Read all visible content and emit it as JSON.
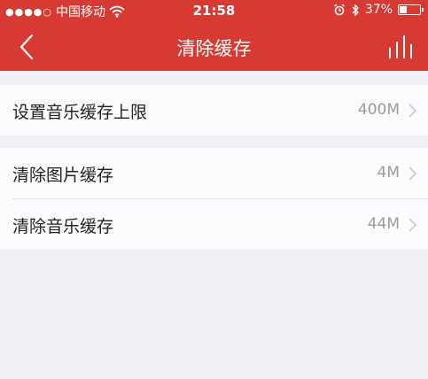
{
  "status_bar": {
    "signal": "●●●●○",
    "carrier": "中国移动",
    "time": "21:58",
    "battery_percent": "37%",
    "battery_level": 0.37
  },
  "nav": {
    "title": "清除缓存",
    "back_icon": "chevron-left-icon",
    "equalizer_icon": "equalizer-icon"
  },
  "settings": [
    {
      "label": "设置音乐缓存上限",
      "value": "400M"
    },
    {
      "label": "清除图片缓存",
      "value": "4M"
    },
    {
      "label": "清除音乐缓存",
      "value": "44M"
    }
  ],
  "colors": {
    "header": "#d63a33",
    "background": "#efeff4",
    "row_background": "#fafbfd",
    "value_text": "#9b9b9b"
  }
}
